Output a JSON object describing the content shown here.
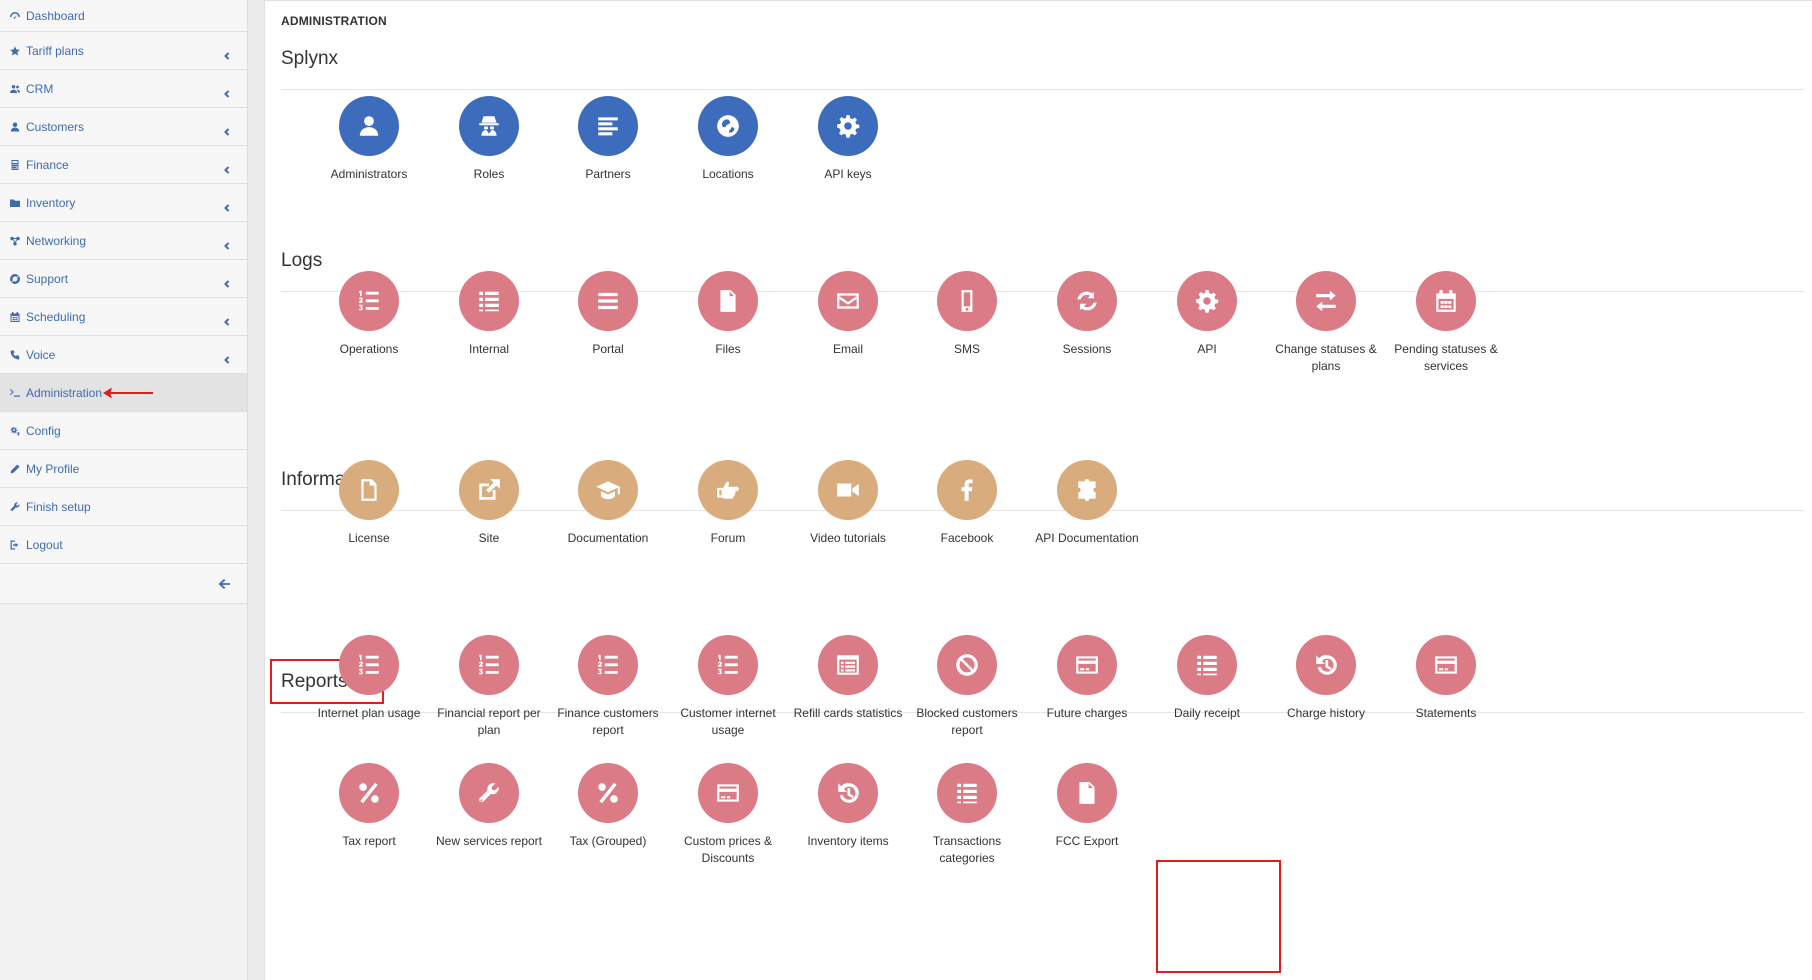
{
  "colors": {
    "link": "#3f6bb3",
    "blue": "#3e6cbc",
    "red": "#db7b86",
    "tan": "#d9ac7d",
    "highlight": "#e21b1b"
  },
  "sidebar": {
    "items": [
      {
        "label": "Dashboard",
        "icon": "dashboard-icon"
      },
      {
        "label": "Tariff plans",
        "icon": "star-icon"
      },
      {
        "label": "CRM",
        "icon": "users-icon"
      },
      {
        "label": "Customers",
        "icon": "user-icon"
      },
      {
        "label": "Finance",
        "icon": "calculator-icon"
      },
      {
        "label": "Inventory",
        "icon": "folder-icon"
      },
      {
        "label": "Networking",
        "icon": "network-icon"
      },
      {
        "label": "Support",
        "icon": "life-ring-icon"
      },
      {
        "label": "Scheduling",
        "icon": "calendar-icon"
      },
      {
        "label": "Voice",
        "icon": "phone-icon"
      },
      {
        "label": "Administration",
        "icon": "terminal-icon"
      },
      {
        "label": "Config",
        "icon": "cogs-icon"
      },
      {
        "label": "My Profile",
        "icon": "pencil-icon"
      },
      {
        "label": "Finish setup",
        "icon": "wrench-icon"
      },
      {
        "label": "Logout",
        "icon": "sign-out-icon"
      }
    ]
  },
  "page": {
    "title": "ADMINISTRATION"
  },
  "sections": {
    "splynx": {
      "title": "Splynx",
      "items": [
        {
          "label": "Administrators",
          "icon": "user-icon"
        },
        {
          "label": "Roles",
          "icon": "user-secret-icon"
        },
        {
          "label": "Partners",
          "icon": "align-left-icon"
        },
        {
          "label": "Locations",
          "icon": "globe-icon"
        },
        {
          "label": "API keys",
          "icon": "gear-icon"
        }
      ]
    },
    "logs": {
      "title": "Logs",
      "items": [
        {
          "label": "Operations",
          "icon": "list-ol-icon"
        },
        {
          "label": "Internal",
          "icon": "list-icon"
        },
        {
          "label": "Portal",
          "icon": "bars-icon"
        },
        {
          "label": "Files",
          "icon": "file-text-icon"
        },
        {
          "label": "Email",
          "icon": "envelope-icon"
        },
        {
          "label": "SMS",
          "icon": "mobile-icon"
        },
        {
          "label": "Sessions",
          "icon": "refresh-icon"
        },
        {
          "label": "API",
          "icon": "gear-icon"
        },
        {
          "label": "Change statuses & plans",
          "icon": "exchange-icon"
        },
        {
          "label": "Pending statuses & services",
          "icon": "calendar-icon"
        }
      ]
    },
    "information": {
      "title": "Information",
      "items": [
        {
          "label": "License",
          "icon": "file-icon"
        },
        {
          "label": "Site",
          "icon": "external-link-icon"
        },
        {
          "label": "Documentation",
          "icon": "graduation-cap-icon"
        },
        {
          "label": "Forum",
          "icon": "hand-pointer-icon"
        },
        {
          "label": "Video tutorials",
          "icon": "video-camera-icon"
        },
        {
          "label": "Facebook",
          "icon": "facebook-icon"
        },
        {
          "label": "API Documentation",
          "icon": "puzzle-icon"
        }
      ]
    },
    "reports": {
      "title": "Reports",
      "items": [
        {
          "label": "Internet plan usage",
          "icon": "list-ol-icon"
        },
        {
          "label": "Financial report per plan",
          "icon": "list-ol-icon"
        },
        {
          "label": "Finance customers report",
          "icon": "list-ol-icon"
        },
        {
          "label": "Customer internet usage",
          "icon": "list-ol-icon"
        },
        {
          "label": "Refill cards statistics",
          "icon": "list-alt-icon"
        },
        {
          "label": "Blocked customers report",
          "icon": "ban-icon"
        },
        {
          "label": "Future charges",
          "icon": "credit-card-icon"
        },
        {
          "label": "Daily receipt",
          "icon": "list-icon"
        },
        {
          "label": "Charge history",
          "icon": "history-icon"
        },
        {
          "label": "Statements",
          "icon": "credit-card-icon"
        },
        {
          "label": "Tax report",
          "icon": "percent-icon"
        },
        {
          "label": "New services report",
          "icon": "wrench-icon"
        },
        {
          "label": "Tax (Grouped)",
          "icon": "percent-icon"
        },
        {
          "label": "Custom prices & Discounts",
          "icon": "credit-card-icon"
        },
        {
          "label": "Inventory items",
          "icon": "history-icon"
        },
        {
          "label": "Transactions categories",
          "icon": "list-icon"
        },
        {
          "label": "FCC Export",
          "icon": "file-text-icon"
        }
      ]
    }
  }
}
